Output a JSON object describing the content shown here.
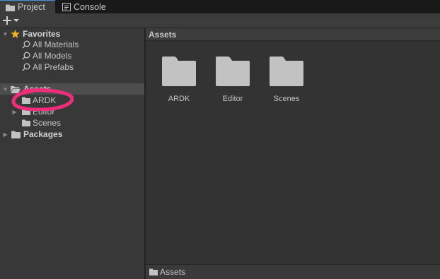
{
  "tabs": [
    {
      "label": "Project",
      "icon": "folder-icon",
      "active": true
    },
    {
      "label": "Console",
      "icon": "console-icon",
      "active": false
    }
  ],
  "toolbar": {
    "add_icon": "plus-icon",
    "dropdown_icon": "chevron-down-icon"
  },
  "tree": {
    "favorites": {
      "label": "Favorites",
      "items": [
        {
          "label": "All Materials"
        },
        {
          "label": "All Models"
        },
        {
          "label": "All Prefabs"
        }
      ]
    },
    "assets": {
      "label": "Assets",
      "children": [
        {
          "label": "ARDK"
        },
        {
          "label": "Editor"
        },
        {
          "label": "Scenes"
        }
      ]
    },
    "packages": {
      "label": "Packages"
    }
  },
  "content": {
    "header": "Assets",
    "folders": [
      {
        "label": "ARDK"
      },
      {
        "label": "Editor"
      },
      {
        "label": "Scenes"
      }
    ],
    "footer_path": "Assets"
  },
  "colors": {
    "annotation": "#ef2d7a",
    "folder": "#c2c2c2",
    "accent": "#4a90d9",
    "star": "#f0b31e"
  }
}
